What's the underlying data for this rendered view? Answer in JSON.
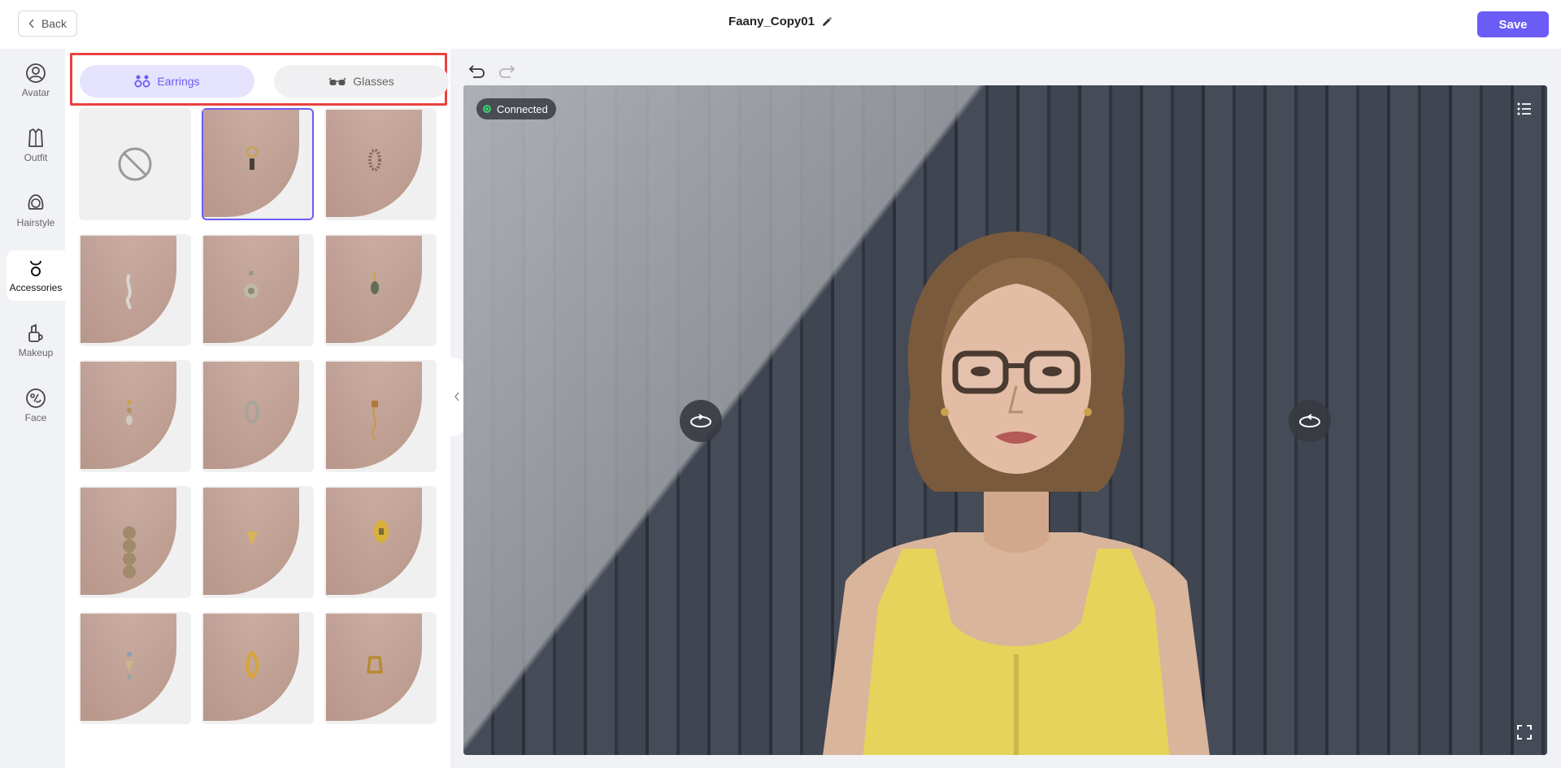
{
  "header": {
    "back_label": "Back",
    "title": "Faany_Copy01",
    "save_label": "Save"
  },
  "nav": {
    "items": [
      {
        "label": "Avatar",
        "icon": "avatar-icon"
      },
      {
        "label": "Outfit",
        "icon": "outfit-icon"
      },
      {
        "label": "Hairstyle",
        "icon": "hairstyle-icon"
      },
      {
        "label": "Accessories",
        "icon": "accessories-icon",
        "active": true
      },
      {
        "label": "Makeup",
        "icon": "makeup-icon"
      },
      {
        "label": "Face",
        "icon": "face-icon"
      }
    ]
  },
  "accessories": {
    "tabs": [
      {
        "label": "Earrings",
        "icon": "earrings-icon",
        "active": true
      },
      {
        "label": "Glasses",
        "icon": "glasses-icon"
      }
    ],
    "selected_index": 1,
    "item_count": 15
  },
  "preview": {
    "status": "Connected",
    "status_color": "#3ad06a"
  },
  "colors": {
    "accent": "#6b5cf5",
    "highlight_box": "#e8423f"
  }
}
